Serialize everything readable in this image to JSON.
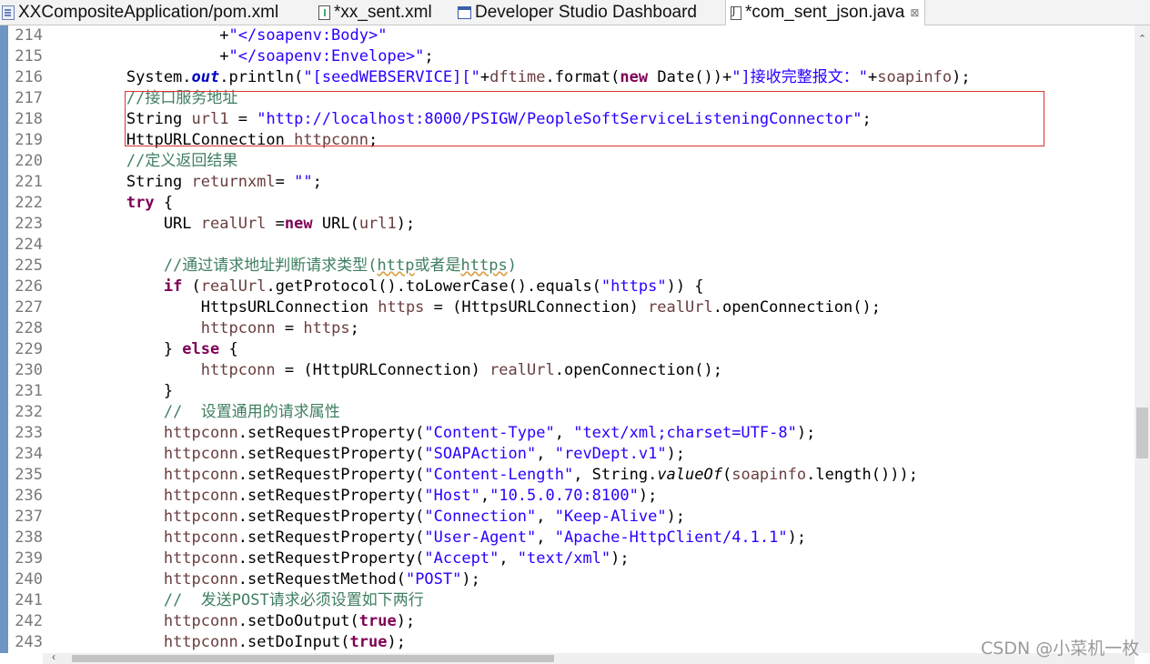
{
  "tabs": [
    {
      "label": "XXCompositeApplication/pom.xml",
      "icon": "maven-pom-icon"
    },
    {
      "label": "*xx_sent.xml",
      "icon": "xml-file-icon"
    },
    {
      "label": "Developer Studio Dashboard",
      "icon": "dashboard-icon"
    },
    {
      "label": "*com_sent_json.java",
      "icon": "java-file-icon",
      "close": "⊠"
    }
  ],
  "lines": [
    {
      "num": "214",
      "parts": [
        {
          "t": "                  +"
        },
        {
          "t": "\"</soapenv:Body>\"",
          "c": "str"
        }
      ]
    },
    {
      "num": "215",
      "parts": [
        {
          "t": "                  +"
        },
        {
          "t": "\"</soapenv:Envelope>\"",
          "c": "str"
        },
        {
          "t": ";"
        }
      ]
    },
    {
      "num": "216",
      "parts": [
        {
          "t": "        System."
        },
        {
          "t": "out",
          "c": "fld"
        },
        {
          "t": ".println("
        },
        {
          "t": "\"[seedWEBSERVICE][\"",
          "c": "str"
        },
        {
          "t": "+"
        },
        {
          "t": "dftime",
          "c": "var"
        },
        {
          "t": ".format("
        },
        {
          "t": "new",
          "c": "kw"
        },
        {
          "t": " Date())+"
        },
        {
          "t": "\"]接收完整报文：\"",
          "c": "str"
        },
        {
          "t": "+"
        },
        {
          "t": "soapinfo",
          "c": "var"
        },
        {
          "t": ");"
        }
      ]
    },
    {
      "num": "217",
      "parts": [
        {
          "t": "        "
        },
        {
          "t": "//接口服务地址",
          "c": "cmt"
        }
      ]
    },
    {
      "num": "218",
      "parts": [
        {
          "t": "        String "
        },
        {
          "t": "url1",
          "c": "var"
        },
        {
          "t": " = "
        },
        {
          "t": "\"http://localhost:8000/PSIGW/PeopleSoftServiceListeningConnector\"",
          "c": "str"
        },
        {
          "t": ";"
        }
      ]
    },
    {
      "num": "219",
      "parts": [
        {
          "t": "        HttpURLConnection "
        },
        {
          "t": "httpconn",
          "c": "var"
        },
        {
          "t": ";"
        }
      ]
    },
    {
      "num": "220",
      "parts": [
        {
          "t": "        "
        },
        {
          "t": "//定义返回结果",
          "c": "cmt"
        }
      ]
    },
    {
      "num": "221",
      "parts": [
        {
          "t": "        String "
        },
        {
          "t": "returnxml",
          "c": "var"
        },
        {
          "t": "= "
        },
        {
          "t": "\"\"",
          "c": "str"
        },
        {
          "t": ";"
        }
      ]
    },
    {
      "num": "222",
      "parts": [
        {
          "t": "        "
        },
        {
          "t": "try",
          "c": "kw"
        },
        {
          "t": " {"
        }
      ]
    },
    {
      "num": "223",
      "parts": [
        {
          "t": "            URL "
        },
        {
          "t": "realUrl",
          "c": "var"
        },
        {
          "t": " ="
        },
        {
          "t": "new",
          "c": "kw"
        },
        {
          "t": " URL("
        },
        {
          "t": "url1",
          "c": "var"
        },
        {
          "t": ");"
        }
      ]
    },
    {
      "num": "224",
      "parts": [
        {
          "t": ""
        }
      ]
    },
    {
      "num": "225",
      "parts": [
        {
          "t": "            "
        },
        {
          "t": "//通过请求地址判断请求类型(",
          "c": "cmt"
        },
        {
          "t": "http",
          "c": "cmt wavy"
        },
        {
          "t": "或者是",
          "c": "cmt"
        },
        {
          "t": "https",
          "c": "cmt wavy"
        },
        {
          "t": ")",
          "c": "cmt"
        }
      ]
    },
    {
      "num": "226",
      "parts": [
        {
          "t": "            "
        },
        {
          "t": "if",
          "c": "kw"
        },
        {
          "t": " ("
        },
        {
          "t": "realUrl",
          "c": "var"
        },
        {
          "t": ".getProtocol().toLowerCase().equals("
        },
        {
          "t": "\"https\"",
          "c": "str"
        },
        {
          "t": ")) {"
        }
      ]
    },
    {
      "num": "227",
      "parts": [
        {
          "t": "                HttpsURLConnection "
        },
        {
          "t": "https",
          "c": "var"
        },
        {
          "t": " = (HttpsURLConnection) "
        },
        {
          "t": "realUrl",
          "c": "var"
        },
        {
          "t": ".openConnection();"
        }
      ]
    },
    {
      "num": "228",
      "parts": [
        {
          "t": "                "
        },
        {
          "t": "httpconn",
          "c": "var"
        },
        {
          "t": " = "
        },
        {
          "t": "https",
          "c": "var"
        },
        {
          "t": ";"
        }
      ]
    },
    {
      "num": "229",
      "parts": [
        {
          "t": "            } "
        },
        {
          "t": "else",
          "c": "kw"
        },
        {
          "t": " {"
        }
      ]
    },
    {
      "num": "230",
      "parts": [
        {
          "t": "                "
        },
        {
          "t": "httpconn",
          "c": "var"
        },
        {
          "t": " = (HttpURLConnection) "
        },
        {
          "t": "realUrl",
          "c": "var"
        },
        {
          "t": ".openConnection();"
        }
      ]
    },
    {
      "num": "231",
      "parts": [
        {
          "t": "            }"
        }
      ]
    },
    {
      "num": "232",
      "parts": [
        {
          "t": "            "
        },
        {
          "t": "//  设置通用的请求属性",
          "c": "cmt"
        }
      ]
    },
    {
      "num": "233",
      "parts": [
        {
          "t": "            "
        },
        {
          "t": "httpconn",
          "c": "var"
        },
        {
          "t": ".setRequestProperty("
        },
        {
          "t": "\"Content-Type\"",
          "c": "str"
        },
        {
          "t": ", "
        },
        {
          "t": "\"text/xml;charset=UTF-8\"",
          "c": "str"
        },
        {
          "t": ");"
        }
      ]
    },
    {
      "num": "234",
      "parts": [
        {
          "t": "            "
        },
        {
          "t": "httpconn",
          "c": "var"
        },
        {
          "t": ".setRequestProperty("
        },
        {
          "t": "\"SOAPAction\"",
          "c": "str"
        },
        {
          "t": ", "
        },
        {
          "t": "\"revDept.v1\"",
          "c": "str"
        },
        {
          "t": ");"
        }
      ]
    },
    {
      "num": "235",
      "parts": [
        {
          "t": "            "
        },
        {
          "t": "httpconn",
          "c": "var"
        },
        {
          "t": ".setRequestProperty("
        },
        {
          "t": "\"Content-Length\"",
          "c": "str"
        },
        {
          "t": ", String."
        },
        {
          "t": "valueOf",
          "c": "itl"
        },
        {
          "t": "("
        },
        {
          "t": "soapinfo",
          "c": "var"
        },
        {
          "t": ".length()));"
        }
      ]
    },
    {
      "num": "236",
      "parts": [
        {
          "t": "            "
        },
        {
          "t": "httpconn",
          "c": "var"
        },
        {
          "t": ".setRequestProperty("
        },
        {
          "t": "\"Host\"",
          "c": "str"
        },
        {
          "t": ","
        },
        {
          "t": "\"10.5.0.70:8100\"",
          "c": "str"
        },
        {
          "t": ");"
        }
      ]
    },
    {
      "num": "237",
      "parts": [
        {
          "t": "            "
        },
        {
          "t": "httpconn",
          "c": "var"
        },
        {
          "t": ".setRequestProperty("
        },
        {
          "t": "\"Connection\"",
          "c": "str"
        },
        {
          "t": ", "
        },
        {
          "t": "\"Keep-Alive\"",
          "c": "str"
        },
        {
          "t": ");"
        }
      ]
    },
    {
      "num": "238",
      "parts": [
        {
          "t": "            "
        },
        {
          "t": "httpconn",
          "c": "var"
        },
        {
          "t": ".setRequestProperty("
        },
        {
          "t": "\"User-Agent\"",
          "c": "str"
        },
        {
          "t": ", "
        },
        {
          "t": "\"Apache-HttpClient/4.1.1\"",
          "c": "str"
        },
        {
          "t": ");"
        }
      ]
    },
    {
      "num": "239",
      "parts": [
        {
          "t": "            "
        },
        {
          "t": "httpconn",
          "c": "var"
        },
        {
          "t": ".setRequestProperty("
        },
        {
          "t": "\"Accept\"",
          "c": "str"
        },
        {
          "t": ", "
        },
        {
          "t": "\"text/xml\"",
          "c": "str"
        },
        {
          "t": ");"
        }
      ]
    },
    {
      "num": "240",
      "parts": [
        {
          "t": "            "
        },
        {
          "t": "httpconn",
          "c": "var"
        },
        {
          "t": ".setRequestMethod("
        },
        {
          "t": "\"POST\"",
          "c": "str"
        },
        {
          "t": ");"
        }
      ]
    },
    {
      "num": "241",
      "parts": [
        {
          "t": "            "
        },
        {
          "t": "//  发送POST请求必须设置如下两行",
          "c": "cmt"
        }
      ]
    },
    {
      "num": "242",
      "parts": [
        {
          "t": "            "
        },
        {
          "t": "httpconn",
          "c": "var"
        },
        {
          "t": ".setDoOutput("
        },
        {
          "t": "true",
          "c": "kw"
        },
        {
          "t": ");"
        }
      ]
    },
    {
      "num": "243",
      "parts": [
        {
          "t": "            "
        },
        {
          "t": "httpconn",
          "c": "var"
        },
        {
          "t": ".setDoInput("
        },
        {
          "t": "true",
          "c": "kw"
        },
        {
          "t": ");"
        }
      ]
    }
  ],
  "watermark": "CSDN @小菜机一枚",
  "colors": {
    "keyword": "#7f0055",
    "string": "#2a00ff",
    "variable": "#6a3e3e",
    "comment": "#3f7f5f",
    "field": "#0000c0",
    "highlight_box": "#e03030"
  }
}
